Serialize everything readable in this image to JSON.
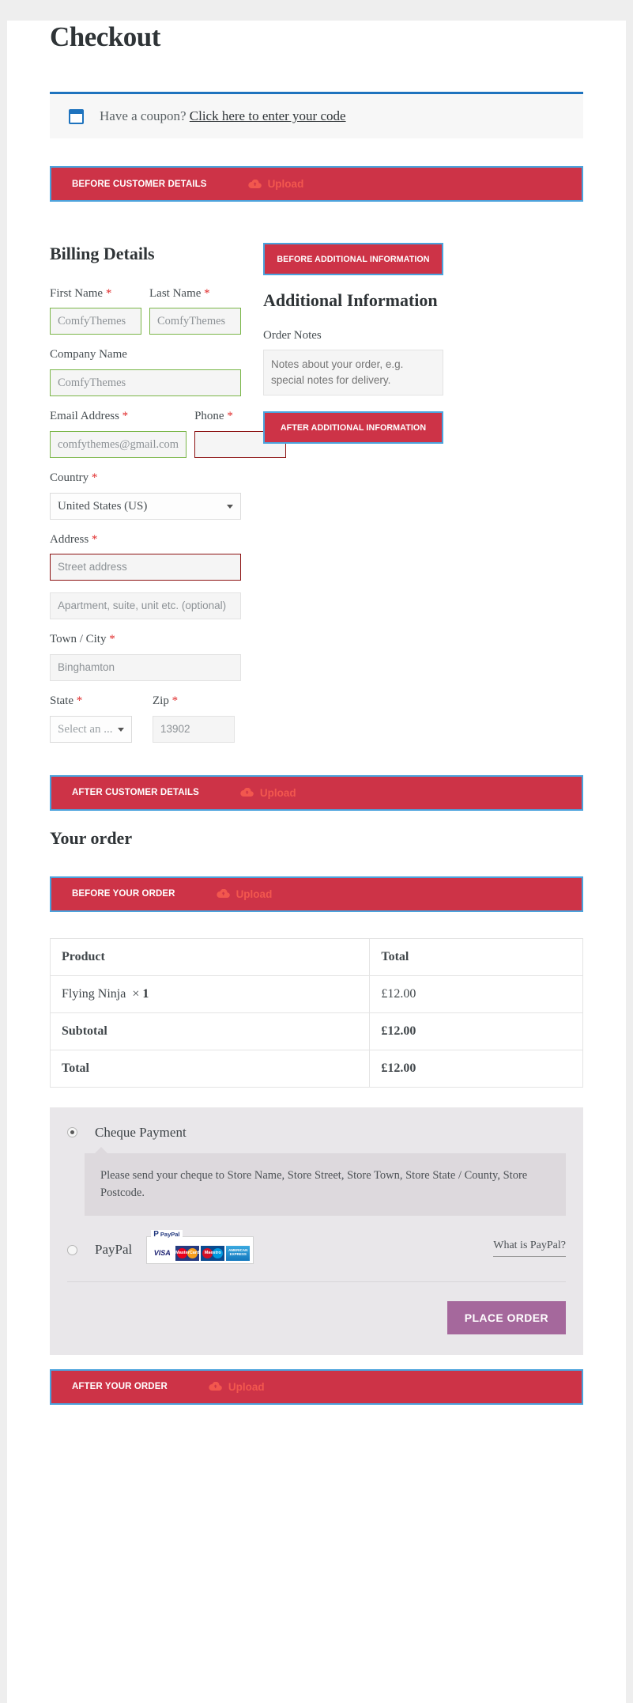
{
  "page": {
    "title": "Checkout"
  },
  "coupon": {
    "icon": "coupon-ticket-icon",
    "text": "Have a coupon? ",
    "link": "Click here to enter your code"
  },
  "hooks": {
    "before_customer_details": "BEFORE CUSTOMER DETAILS",
    "after_customer_details": "AFTER CUSTOMER DETAILS",
    "before_additional_information": "BEFORE ADDITIONAL INFORMATION",
    "after_additional_information": "AFTER ADDITIONAL INFORMATION",
    "before_your_order": "BEFORE YOUR ORDER",
    "after_your_order": "AFTER YOUR ORDER",
    "upload_label": "Upload",
    "upload_icon": "cloud-upload-icon",
    "bar_color": "#cd3347",
    "bar_border_color": "#4ba3dd",
    "upload_color": "#f2574e"
  },
  "billing": {
    "heading": "Billing Details",
    "required_mark": "*",
    "fields": {
      "first_name": {
        "label": "First Name",
        "value": "",
        "placeholder": "ComfyThemes",
        "required": true,
        "state": "valid"
      },
      "last_name": {
        "label": "Last Name",
        "value": "",
        "placeholder": "ComfyThemes",
        "required": true,
        "state": "valid"
      },
      "company_name": {
        "label": "Company Name",
        "value": "",
        "placeholder": "ComfyThemes",
        "required": false,
        "state": "valid"
      },
      "email": {
        "label": "Email Address",
        "value": "",
        "placeholder": "comfythemes@gmail.com",
        "required": true,
        "state": "valid"
      },
      "phone": {
        "label": "Phone",
        "value": "",
        "placeholder": "",
        "required": true,
        "state": "error"
      },
      "country": {
        "label": "Country",
        "value": "United States (US)",
        "required": true,
        "state": "default"
      },
      "address_1": {
        "label": "Address",
        "value": "",
        "placeholder": "Street address",
        "required": true,
        "state": "error"
      },
      "address_2": {
        "label": "",
        "value": "",
        "placeholder": "Apartment, suite, unit etc. (optional)",
        "required": false,
        "state": "default"
      },
      "city": {
        "label": "Town / City",
        "value": "",
        "placeholder": "Binghamton",
        "required": true,
        "state": "default"
      },
      "state": {
        "label": "State",
        "value": "Select an ...",
        "required": true,
        "state": "default"
      },
      "zip": {
        "label": "Zip",
        "value": "",
        "placeholder": "13902",
        "required": true,
        "state": "default"
      }
    }
  },
  "additional": {
    "heading": "Additional Information",
    "order_notes_label": "Order Notes",
    "order_notes_value": "",
    "order_notes_placeholder": "Notes about your order, e.g. special notes for delivery."
  },
  "order": {
    "heading": "Your order",
    "columns": [
      "Product",
      "Total"
    ],
    "rows": [
      {
        "product": "Flying Ninja",
        "qty_sep": "×",
        "qty": "1",
        "total": "£12.00",
        "strong": false
      },
      {
        "product": "Subtotal",
        "qty_sep": "",
        "qty": "",
        "total": "£12.00",
        "strong": true
      },
      {
        "product": "Total",
        "qty_sep": "",
        "qty": "",
        "total": "£12.00",
        "strong": true
      }
    ]
  },
  "payment": {
    "methods": [
      {
        "id": "cheque",
        "label": "Cheque Payment",
        "selected": true
      },
      {
        "id": "paypal",
        "label": "PayPal",
        "selected": false
      }
    ],
    "cheque_description": "Please send your cheque to Store Name, Store Street, Store Town, Store State / County, Store Postcode.",
    "paypal_brand": "PayPal",
    "cards": [
      "VISA",
      "MasterCard",
      "Maestro",
      "AMERICAN EXPRESS"
    ],
    "what_is_paypal": "What is PayPal?",
    "place_order_label": "PLACE ORDER",
    "place_order_color": "#a5689c"
  }
}
